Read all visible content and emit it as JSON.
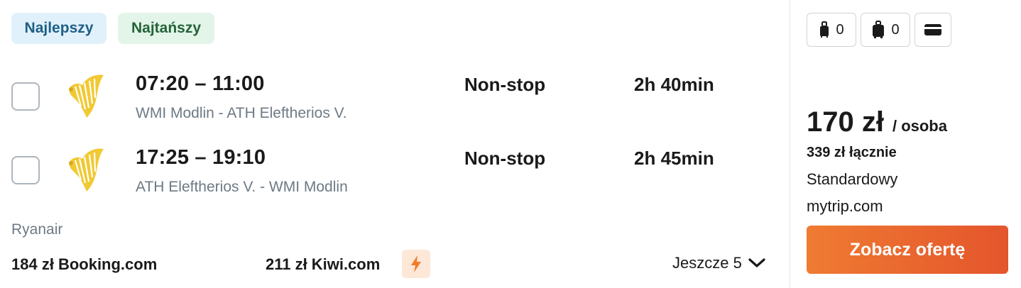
{
  "badges": {
    "best": "Najlepszy",
    "cheapest": "Najtańszy"
  },
  "legs": [
    {
      "times": "07:20 – 11:00",
      "route": "WMI Modlin - ATH Eleftherios V.",
      "stops": "Non-stop",
      "duration": "2h 40min"
    },
    {
      "times": "17:25 – 19:10",
      "route": "ATH Eleftherios V. - WMI Modlin",
      "stops": "Non-stop",
      "duration": "2h 45min"
    }
  ],
  "airline": "Ryanair",
  "alternatives": [
    {
      "price": "184 zł",
      "vendor": "Booking.com"
    },
    {
      "price": "211 zł",
      "vendor": "Kiwi.com"
    }
  ],
  "more_label": "Jeszcze 5",
  "bags": {
    "cabin_count": "0",
    "checked_count": "0"
  },
  "offer": {
    "price": "170 zł",
    "per_person": "/ osoba",
    "total": "339 zł łącznie",
    "fare_type": "Standardowy",
    "vendor": "mytrip.com",
    "cta": "Zobacz ofertę"
  },
  "colors": {
    "accent": "#e8612e",
    "best_badge_bg": "#e1f1fb",
    "cheap_badge_bg": "#e3f5e8",
    "airline_logo": "#f1c933"
  },
  "icons": [
    "ryanair-harp-logo",
    "cabin-bag-icon",
    "checked-bag-icon",
    "credit-card-icon",
    "lightning-icon",
    "chevron-down-icon"
  ]
}
